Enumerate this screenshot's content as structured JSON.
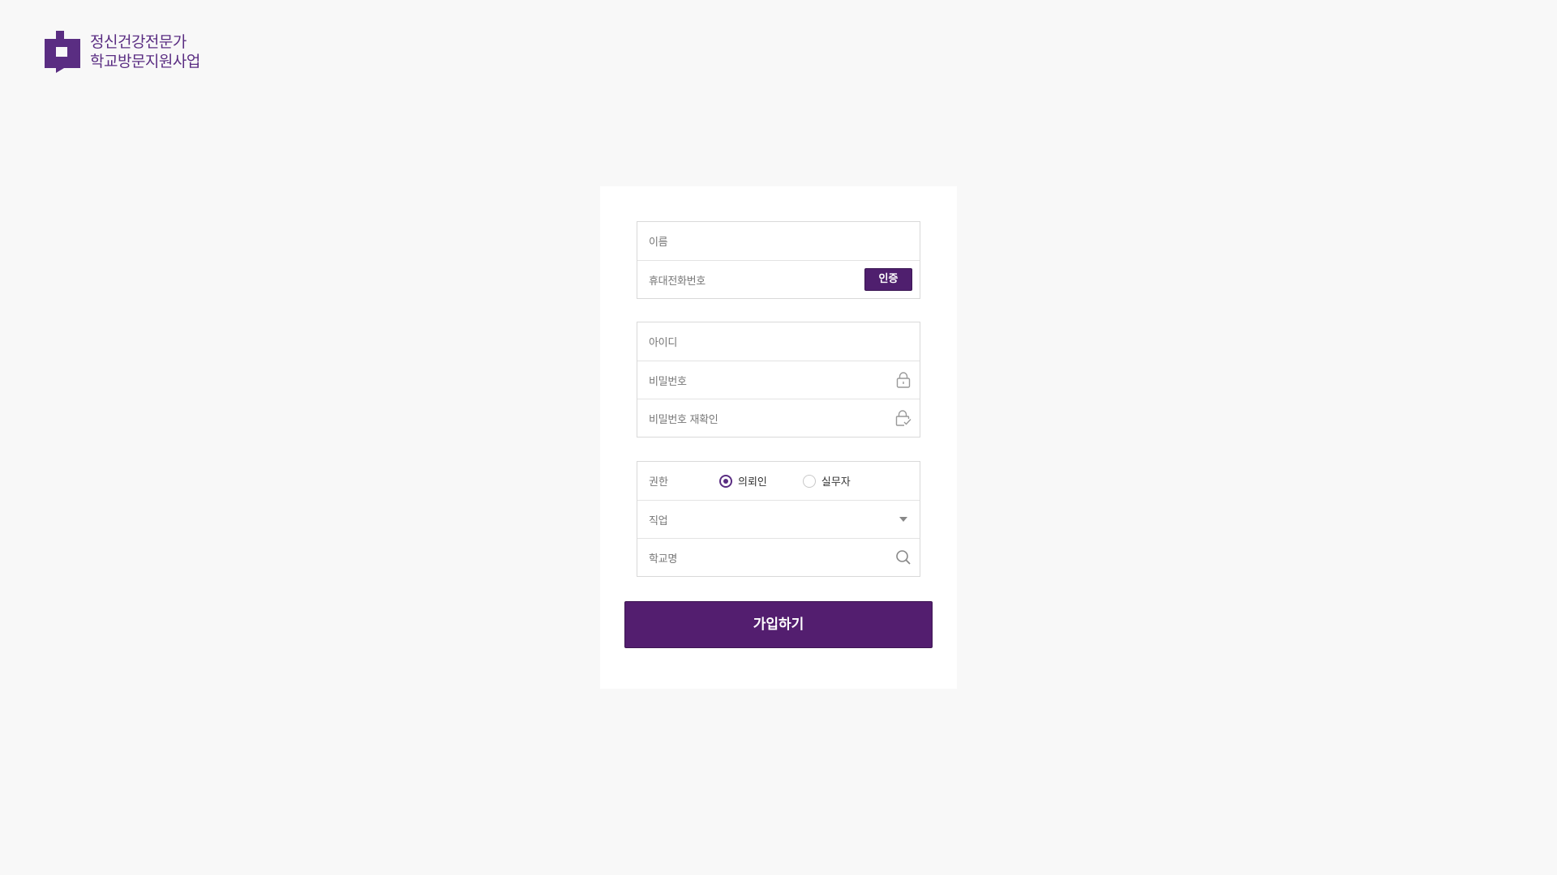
{
  "brand": {
    "line1": "정신건강전문가",
    "line2": "학교방문지원사업",
    "color": "#5a2d82"
  },
  "form": {
    "identity": {
      "name_placeholder": "이름",
      "phone_placeholder": "휴대전화번호",
      "verify_label": "인증"
    },
    "account": {
      "id_placeholder": "아이디",
      "password_placeholder": "비밀번호",
      "password_confirm_placeholder": "비밀번호 재확인",
      "password_icon": "lock-icon",
      "password_confirm_icon": "lock-check-icon"
    },
    "role": {
      "label": "권한",
      "options": [
        "의뢰인",
        "실무자"
      ],
      "selected": "의뢰인"
    },
    "job": {
      "placeholder": "직업",
      "icon": "caret-down-icon"
    },
    "school": {
      "placeholder": "학교명",
      "icon": "search-icon"
    },
    "submit_label": "가입하기"
  },
  "colors": {
    "accent": "#531e6f",
    "background": "#f8f8f8"
  }
}
